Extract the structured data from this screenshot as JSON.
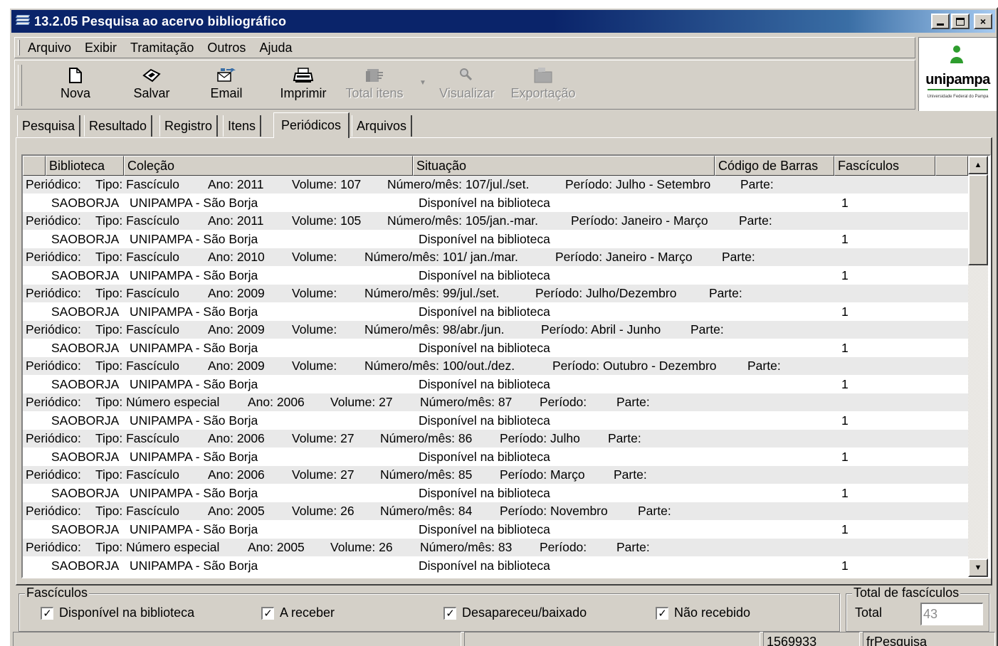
{
  "window": {
    "title": "13.2.05 Pesquisa ao acervo bibliográfico",
    "min_icon": "minimize-icon",
    "max_icon": "maximize-icon",
    "close_glyph": "×"
  },
  "menu": [
    "Arquivo",
    "Exibir",
    "Tramitação",
    "Outros",
    "Ajuda"
  ],
  "toolbar": {
    "nova": "Nova",
    "salvar": "Salvar",
    "email": "Email",
    "imprimir": "Imprimir",
    "total_itens": "Total itens",
    "visualizar": "Visualizar",
    "exportacao": "Exportação"
  },
  "logo": {
    "name": "unipampa",
    "subtitle": "Universidade Federal do Pampa"
  },
  "tabs": [
    "Pesquisa",
    "Resultado",
    "Registro",
    "Itens",
    "Periódicos",
    "Arquivos"
  ],
  "active_tab": "Periódicos",
  "grid": {
    "columns": [
      "Biblioteca",
      "Coleção",
      "Situação",
      "Código de Barras",
      "Fascículos"
    ],
    "entries": [
      {
        "tipo": "Tipo: Fascículo",
        "ano": "Ano: 2011",
        "volume": "Volume: 107",
        "numero": "Número/mês: 107/jul./set.",
        "periodo": "Período: Julho - Setembro",
        "parte": "Parte:",
        "biblioteca": "SAOBORJA",
        "colecao": "UNIPAMPA - São Borja",
        "situacao": "Disponível na biblioteca",
        "fasciculos": "1"
      },
      {
        "tipo": "Tipo: Fascículo",
        "ano": "Ano: 2011",
        "volume": "Volume: 105",
        "numero": "Número/mês: 105/jan.-mar.",
        "periodo": "Período: Janeiro - Março",
        "parte": "Parte:",
        "biblioteca": "SAOBORJA",
        "colecao": "UNIPAMPA - São Borja",
        "situacao": "Disponível na biblioteca",
        "fasciculos": "1"
      },
      {
        "tipo": "Tipo: Fascículo",
        "ano": "Ano: 2010",
        "volume": "Volume:",
        "numero": "Número/mês: 101/ jan./mar.",
        "periodo": "Período: Janeiro - Março",
        "parte": "Parte:",
        "biblioteca": "SAOBORJA",
        "colecao": "UNIPAMPA - São Borja",
        "situacao": "Disponível na biblioteca",
        "fasciculos": "1"
      },
      {
        "tipo": "Tipo: Fascículo",
        "ano": "Ano: 2009",
        "volume": "Volume:",
        "numero": "Número/mês: 99/jul./set.",
        "periodo": "Período: Julho/Dezembro",
        "parte": "Parte:",
        "biblioteca": "SAOBORJA",
        "colecao": "UNIPAMPA - São Borja",
        "situacao": "Disponível na biblioteca",
        "fasciculos": "1"
      },
      {
        "tipo": "Tipo: Fascículo",
        "ano": "Ano: 2009",
        "volume": "Volume:",
        "numero": "Número/mês: 98/abr./jun.",
        "periodo": "Período: Abril - Junho",
        "parte": "Parte:",
        "biblioteca": "SAOBORJA",
        "colecao": "UNIPAMPA - São Borja",
        "situacao": "Disponível na biblioteca",
        "fasciculos": "1"
      },
      {
        "tipo": "Tipo: Fascículo",
        "ano": "Ano: 2009",
        "volume": "Volume:",
        "numero": "Número/mês: 100/out./dez.",
        "periodo": "Período: Outubro - Dezembro",
        "parte": "Parte:",
        "biblioteca": "SAOBORJA",
        "colecao": "UNIPAMPA - São Borja",
        "situacao": "Disponível na biblioteca",
        "fasciculos": "1"
      },
      {
        "tipo": "Tipo: Número especial",
        "ano": "Ano: 2006",
        "volume": "Volume: 27",
        "numero": "Número/mês: 87",
        "periodo": "Período:",
        "parte": "Parte:",
        "biblioteca": "SAOBORJA",
        "colecao": "UNIPAMPA - São Borja",
        "situacao": "Disponível na biblioteca",
        "fasciculos": "1"
      },
      {
        "tipo": "Tipo: Fascículo",
        "ano": "Ano: 2006",
        "volume": "Volume: 27",
        "numero": "Número/mês: 86",
        "periodo": "Período: Julho",
        "parte": "Parte:",
        "biblioteca": "SAOBORJA",
        "colecao": "UNIPAMPA - São Borja",
        "situacao": "Disponível na biblioteca",
        "fasciculos": "1"
      },
      {
        "tipo": "Tipo: Fascículo",
        "ano": "Ano: 2006",
        "volume": "Volume: 27",
        "numero": "Número/mês: 85",
        "periodo": "Período: Março",
        "parte": "Parte:",
        "biblioteca": "SAOBORJA",
        "colecao": "UNIPAMPA - São Borja",
        "situacao": "Disponível na biblioteca",
        "fasciculos": "1"
      },
      {
        "tipo": "Tipo: Fascículo",
        "ano": "Ano: 2005",
        "volume": "Volume: 26",
        "numero": "Número/mês: 84",
        "periodo": "Período: Novembro",
        "parte": "Parte:",
        "biblioteca": "SAOBORJA",
        "colecao": "UNIPAMPA - São Borja",
        "situacao": "Disponível na biblioteca",
        "fasciculos": "1"
      },
      {
        "tipo": "Tipo: Número especial",
        "ano": "Ano: 2005",
        "volume": "Volume: 26",
        "numero": "Número/mês: 83",
        "periodo": "Período:",
        "parte": "Parte:",
        "biblioteca": "SAOBORJA",
        "colecao": "UNIPAMPA - São Borja",
        "situacao": "Disponível na biblioteca",
        "fasciculos": "1"
      }
    ],
    "row_prefix": "Periódico:"
  },
  "fasciculos_group": {
    "legend": "Fascículos",
    "checks": [
      {
        "label": "Disponível na biblioteca",
        "checked": true
      },
      {
        "label": "A receber",
        "checked": true
      },
      {
        "label": "Desapareceu/baixado",
        "checked": true
      },
      {
        "label": "Não recebido",
        "checked": true
      }
    ],
    "check_glyph": "✓"
  },
  "total_group": {
    "legend": "Total de fascículos",
    "label": "Total",
    "value": "43"
  },
  "status": {
    "code": "1569933",
    "form": "frPesquisa"
  }
}
